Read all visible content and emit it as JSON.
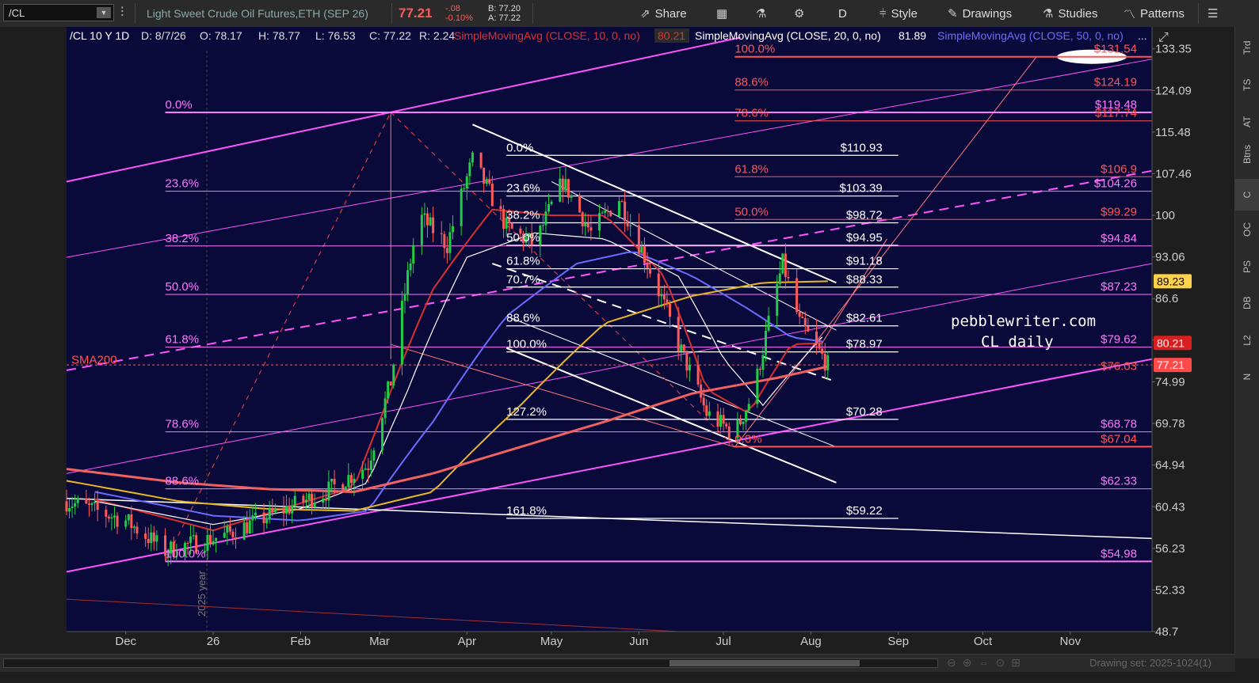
{
  "toolbar": {
    "symbol": "/CL",
    "description": "Light Sweet Crude Oil Futures,ETH (SEP 26)",
    "last": "77.21",
    "change": "-.08",
    "change_pct": "-0.10%",
    "bid": "B: 77.20",
    "ask": "A: 77.22",
    "share": "Share",
    "period": "D",
    "style": "Style",
    "drawings": "Drawings",
    "studies": "Studies",
    "patterns": "Patterns"
  },
  "header_info": {
    "symbol_period": "/CL 10 Y 1D",
    "date": "D: 8/7/26",
    "open": "O: 78.17",
    "high": "H: 78.77",
    "low": "L: 76.53",
    "close": "C: 77.22",
    "range": "R: 2.24",
    "sma10_label": "SimpleMovingAvg (CLOSE, 10, 0, no)",
    "sma10_value": "80.21",
    "sma20_label": "SimpleMovingAvg (CLOSE, 20, 0, no)",
    "sma20_value": "81.89",
    "sma50_label": "SimpleMovingAvg (CLOSE, 50, 0, no)"
  },
  "right_tabs": [
    "Trd",
    "TS",
    "AT",
    "Btns",
    "C",
    "OC",
    "PS",
    "DB",
    "L2",
    "N"
  ],
  "bottom": {
    "drawing_set": "Drawing set: 2025-1024(1)"
  },
  "chart_data": {
    "type": "candlestick",
    "y_axis": {
      "ticks": [
        133.35,
        124.09,
        115.48,
        107.46,
        100,
        93.06,
        86.6,
        80.6,
        74.99,
        69.78,
        64.94,
        60.43,
        56.23,
        52.33,
        48.7
      ],
      "tick_labels": [
        "133.35",
        "124.09",
        "115.48",
        "107.46",
        "100",
        "93.06",
        "86.6",
        "",
        "74.99",
        "69.78",
        "64.94",
        "60.43",
        "56.23",
        "52.33",
        "48.7"
      ],
      "range": [
        48.7,
        138.5
      ],
      "scale": "log"
    },
    "x_axis": {
      "labels": [
        "Dec",
        "26",
        "Feb",
        "Mar",
        "Apr",
        "May",
        "Jun",
        "Jul",
        "Aug",
        "Sep",
        "Oct",
        "Nov"
      ],
      "label_dates": [
        "2025-12-01",
        "2026-01-01",
        "2026-02-01",
        "2026-03-01",
        "2026-04-01",
        "2026-05-01",
        "2026-06-01",
        "2026-07-01",
        "2026-08-01",
        "2026-09-01",
        "2026-10-01",
        "2026-11-01"
      ],
      "range": [
        "2025-11-10",
        "2026-11-30"
      ],
      "year_marker": "2025 year",
      "year_marker_date": "2026-01-01"
    },
    "price_badges": [
      {
        "label": "89.23",
        "value": 89.23,
        "color": "#ffd24d",
        "text_color": "#000000"
      },
      {
        "label": "80.21",
        "value": 80.21,
        "color": "#d81e1e",
        "text_color": "#ffffff"
      },
      {
        "label": "77.21",
        "value": 77.21,
        "color": "#ff4a4a",
        "text_color": "#ffffff"
      }
    ],
    "moving_averages": [
      {
        "name": "SMA10",
        "color": "#d83030",
        "anchors": [
          [
            "2025-11-20",
            61.2
          ],
          [
            "2026-01-01",
            58.0
          ],
          [
            "2026-02-01",
            60.8
          ],
          [
            "2026-02-20",
            62.5
          ],
          [
            "2026-03-01",
            70
          ],
          [
            "2026-03-20",
            88
          ],
          [
            "2026-04-10",
            101
          ],
          [
            "2026-05-01",
            100
          ],
          [
            "2026-05-20",
            100
          ],
          [
            "2026-06-10",
            90
          ],
          [
            "2026-06-25",
            74
          ],
          [
            "2026-07-10",
            71
          ],
          [
            "2026-07-25",
            80
          ],
          [
            "2026-08-07",
            80.21
          ]
        ]
      },
      {
        "name": "SMA20",
        "color": "#ffffff",
        "anchors": [
          [
            "2025-11-20",
            61.0
          ],
          [
            "2026-01-01",
            58.6
          ],
          [
            "2026-02-01",
            60.2
          ],
          [
            "2026-02-25",
            63
          ],
          [
            "2026-03-10",
            73
          ],
          [
            "2026-04-01",
            93
          ],
          [
            "2026-04-25",
            97
          ],
          [
            "2026-05-20",
            96
          ],
          [
            "2026-06-15",
            90
          ],
          [
            "2026-07-01",
            78
          ],
          [
            "2026-07-15",
            72
          ],
          [
            "2026-08-07",
            81.89
          ]
        ]
      },
      {
        "name": "SMA50",
        "color": "#6b6bff",
        "anchors": [
          [
            "2025-11-20",
            62
          ],
          [
            "2026-01-01",
            59.5
          ],
          [
            "2026-02-01",
            59
          ],
          [
            "2026-02-25",
            60
          ],
          [
            "2026-03-20",
            70
          ],
          [
            "2026-04-15",
            84
          ],
          [
            "2026-05-10",
            92
          ],
          [
            "2026-05-30",
            94
          ],
          [
            "2026-06-20",
            90
          ],
          [
            "2026-07-10",
            85
          ],
          [
            "2026-07-25",
            81
          ],
          [
            "2026-08-07",
            80.3
          ]
        ]
      },
      {
        "name": "SMA100",
        "color": "#e8b820",
        "anchors": [
          [
            "2025-11-10",
            63.2
          ],
          [
            "2025-12-20",
            61
          ],
          [
            "2026-01-20",
            60.2
          ],
          [
            "2026-02-20",
            60
          ],
          [
            "2026-03-20",
            62
          ],
          [
            "2026-04-20",
            72
          ],
          [
            "2026-05-20",
            83
          ],
          [
            "2026-06-20",
            87
          ],
          [
            "2026-07-15",
            89
          ],
          [
            "2026-08-07",
            89.23
          ]
        ]
      },
      {
        "name": "SMA200",
        "color": "#f06262",
        "label": "SMA200",
        "anchors": [
          [
            "2025-11-10",
            64.5
          ],
          [
            "2025-12-20",
            63
          ],
          [
            "2026-01-20",
            62.3
          ],
          [
            "2026-02-20",
            62
          ],
          [
            "2026-03-20",
            64
          ],
          [
            "2026-04-20",
            67
          ],
          [
            "2026-05-20",
            70
          ],
          [
            "2026-06-20",
            73.5
          ],
          [
            "2026-07-20",
            75.5
          ],
          [
            "2026-08-07",
            77.0
          ]
        ]
      }
    ],
    "candles_path": [
      [
        "2025-11-10",
        61
      ],
      [
        "2025-12-01",
        59
      ],
      [
        "2025-12-15",
        56
      ],
      [
        "2026-01-05",
        57.5
      ],
      [
        "2026-01-25",
        60
      ],
      [
        "2026-02-10",
        62
      ],
      [
        "2026-02-25",
        65
      ],
      [
        "2026-03-05",
        75
      ],
      [
        "2026-03-15",
        100
      ],
      [
        "2026-03-25",
        95
      ],
      [
        "2026-04-03",
        110
      ],
      [
        "2026-04-15",
        98
      ],
      [
        "2026-04-25",
        95
      ],
      [
        "2026-05-05",
        106
      ],
      [
        "2026-05-15",
        97
      ],
      [
        "2026-05-25",
        103
      ],
      [
        "2026-06-05",
        91
      ],
      [
        "2026-06-15",
        80
      ],
      [
        "2026-06-25",
        71
      ],
      [
        "2026-07-05",
        68.5
      ],
      [
        "2026-07-12",
        74
      ],
      [
        "2026-07-22",
        92
      ],
      [
        "2026-07-28",
        83
      ],
      [
        "2026-08-07",
        77.2
      ]
    ],
    "fibonacci_left": {
      "color": "#ff77ff",
      "levels": [
        {
          "label": "0.0%",
          "value": 119.48
        },
        {
          "label": "23.6%",
          "value": 104.26
        },
        {
          "label": "38.2%",
          "value": 94.84
        },
        {
          "label": "50.0%",
          "value": 87.23
        },
        {
          "label": "61.8%",
          "value": 79.62
        },
        {
          "label": "78.6%",
          "value": 68.78
        },
        {
          "label": "88.6%",
          "value": 62.33
        },
        {
          "label": "100.0%",
          "value": 54.98
        }
      ],
      "right_labels": [
        "$119.48",
        "$104.26",
        "$94.84",
        "$87.23",
        "$79.62",
        "$68.78",
        "$62.33",
        "$54.98"
      ],
      "extra_labels": [
        {
          "label": "$117.74",
          "value": 117.74
        },
        {
          "label": "$76.03",
          "value": 76.03
        }
      ]
    },
    "fibonacci_mid": {
      "color": "#ffffff",
      "levels": [
        {
          "label": "0.0%",
          "value": 110.93,
          "price": "$110.93"
        },
        {
          "label": "23.6%",
          "value": 103.39,
          "price": "$103.39"
        },
        {
          "label": "38.2%",
          "value": 98.72,
          "price": "$98.72"
        },
        {
          "label": "50.0%",
          "value": 94.95,
          "price": "$94.95"
        },
        {
          "label": "61.8%",
          "value": 91.18,
          "price": "$91.18"
        },
        {
          "label": "70.7%",
          "value": 88.33,
          "price": "$88.33"
        },
        {
          "label": "88.6%",
          "value": 82.61,
          "price": "$82.61"
        },
        {
          "label": "100.0%",
          "value": 78.97,
          "price": "$78.97"
        },
        {
          "label": "127.2%",
          "value": 70.28,
          "price": "$70.28"
        },
        {
          "label": "161.8%",
          "value": 59.22,
          "price": "$59.22"
        }
      ]
    },
    "fibonacci_right": {
      "color": "#ff5555",
      "levels": [
        {
          "label": "100.0%",
          "value": 131.54,
          "price": "$131.54"
        },
        {
          "label": "88.6%",
          "value": 124.19,
          "price": "$124.19"
        },
        {
          "label": "78.6%",
          "value": 117.74,
          "price": ""
        },
        {
          "label": "61.8%",
          "value": 106.9,
          "price": "$106.9"
        },
        {
          "label": "50.0%",
          "value": 99.29,
          "price": "$99.29"
        },
        {
          "label": "0.0%",
          "value": 67.04,
          "price": "$67.04"
        }
      ]
    },
    "annotation": {
      "line1": "pebblewriter.com",
      "line2": "CL daily"
    }
  }
}
